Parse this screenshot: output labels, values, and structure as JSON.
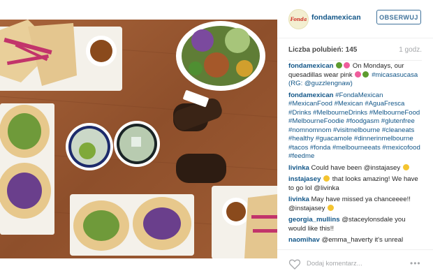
{
  "post": {
    "photo_alt": "",
    "username": "fondamexican",
    "avatar_text": "Fonda",
    "follow_label": "OBSERWUJ",
    "likes": "Liczba polubień: 145",
    "time": "1 godz."
  },
  "comments": [
    {
      "user": "fondamexican",
      "text": " On Mondays, our quesadillas wear pink ",
      "extra": "#micasasucasa (RG: @guzzlengnaw)"
    },
    {
      "user": "fondamexican",
      "text": " #FondaMexican #MexicanFood #Mexican #AguaFresca #Drinks #MelbourneDrinks #MelbourneFood #MelbourneFoodie #foodgasm #glutenfree #nomnomnom #visitmelbourne #cleaneats #healthy #guacamole #dinnerinmelbourne #tacos #fonda #melbourneeats #mexicofood #feedme"
    },
    {
      "user": "livinka",
      "text": " Could have been @instajasey "
    },
    {
      "user": "instajasey",
      "text": " that looks amazing! We have to go lol @livinka"
    },
    {
      "user": "livinka",
      "text": " May have missed ya chanceeee!! @instajasey "
    },
    {
      "user": "georgia_mullins",
      "text": " @staceylonsdale you would like this!!"
    },
    {
      "user": "naomihav",
      "text": " @emma_haverty it's unreal"
    }
  ],
  "footer": {
    "add_comment": "Dodaj komentarz...",
    "more": "•••"
  },
  "colors": {
    "link": "#125688",
    "follow": "#3f729b",
    "muted": "#a5a7aa"
  }
}
